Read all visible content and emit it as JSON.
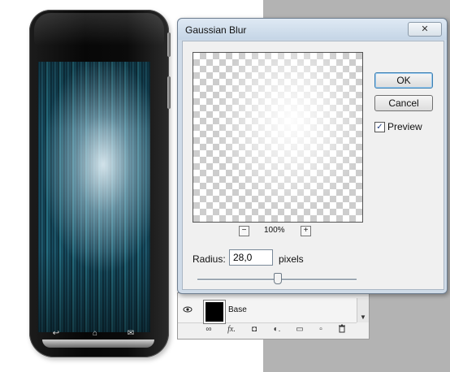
{
  "dialog": {
    "title": "Gaussian Blur",
    "close_glyph": "✕",
    "ok_label": "OK",
    "cancel_label": "Cancel",
    "preview_label": "Preview",
    "preview_checked": true,
    "zoom_minus": "−",
    "zoom_plus": "+",
    "zoom_level": "100%",
    "radius_label": "Radius:",
    "radius_value": "28,0",
    "radius_unit": "pixels",
    "radius_slider_fraction": 0.5
  },
  "layers": {
    "layer_name": "Base",
    "eye_icon": "eye-icon",
    "scroll_arrow": "▼",
    "tools": [
      {
        "icon": "link-layers-icon",
        "glyph": "∞"
      },
      {
        "icon": "fx-icon",
        "glyph": "fx."
      },
      {
        "icon": "add-mask-icon",
        "glyph": "◘"
      },
      {
        "icon": "adjustment-layer-icon",
        "glyph": "◐."
      },
      {
        "icon": "new-group-icon",
        "glyph": "▭"
      },
      {
        "icon": "new-layer-icon",
        "glyph": "▫"
      },
      {
        "icon": "delete-layer-icon",
        "glyph": "🗑"
      }
    ]
  },
  "phone": {
    "keys": [
      "↩",
      "⌂",
      "✉"
    ]
  },
  "colors": {
    "background_panel": "#b3b3b3",
    "dialog_frame": "#cfdbe8",
    "default_button_border": "#3c7fb1"
  }
}
